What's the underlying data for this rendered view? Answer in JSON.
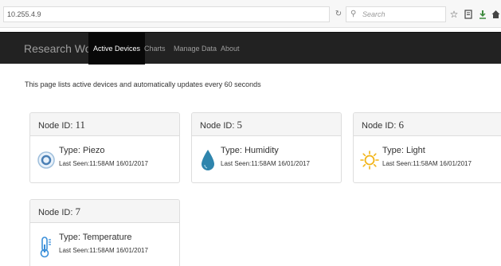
{
  "browser": {
    "url": "10.255.4.9",
    "search_placeholder": "Search",
    "icons": [
      "reload-icon",
      "search-icon",
      "star-icon",
      "reading-list-icon",
      "download-icon",
      "home-icon"
    ]
  },
  "navbar": {
    "brand": "Research Work",
    "items": [
      {
        "label": "Active Devices",
        "active": true
      },
      {
        "label": "Charts",
        "active": false
      },
      {
        "label": "Manage Data",
        "active": false
      },
      {
        "label": "About",
        "active": false
      }
    ],
    "colors": {
      "background": "#222222",
      "active": "#080808",
      "text": "#9d9d9d"
    }
  },
  "lead_text": "This page lists active devices and automatically updates every 60 seconds",
  "devices": [
    {
      "node_label": "Node ID:",
      "node_id": "11",
      "type": "Type: Piezo",
      "last_seen": "Last Seen:11:58AM 16/01/2017",
      "icon": "piezo-icon",
      "color": "#4a7fb5"
    },
    {
      "node_label": "Node ID:",
      "node_id": "5",
      "type": "Type: Humidity",
      "last_seen": "Last Seen:11:58AM 16/01/2017",
      "icon": "water-drop-icon",
      "color": "#2f85ad"
    },
    {
      "node_label": "Node ID:",
      "node_id": "6",
      "type": "Type: Light",
      "last_seen": "Last Seen:11:58AM 16/01/2017",
      "icon": "sun-icon",
      "color": "#f2b417"
    },
    {
      "node_label": "Node ID:",
      "node_id": "7",
      "type": "Type: Temperature",
      "last_seen": "Last Seen:11:58AM 16/01/2017",
      "icon": "thermometer-icon",
      "color": "#3a8fd9"
    }
  ]
}
